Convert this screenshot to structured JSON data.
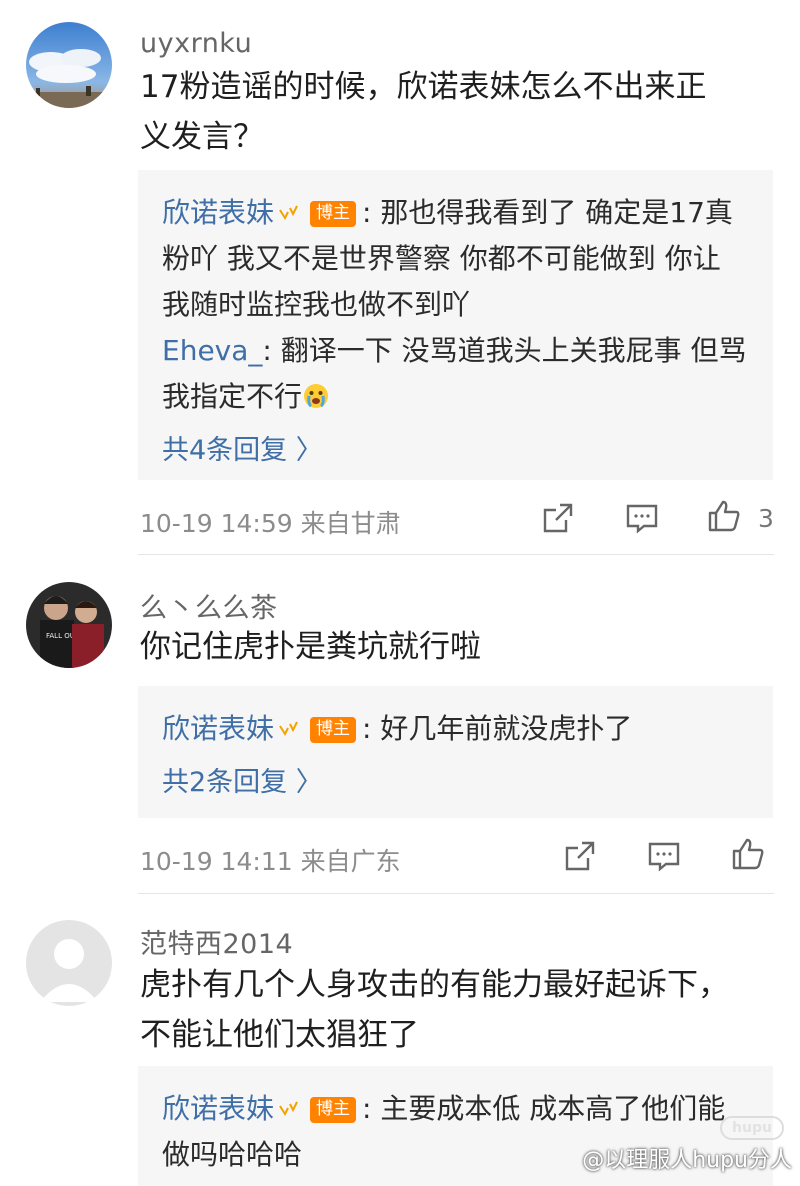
{
  "comments": [
    {
      "username": "uyxrnku",
      "text_line1": "17粉造谣的时候，欣诺表妹怎么不出来正",
      "text_line2": "义发言？",
      "replies": [
        {
          "name": "欣诺表妹",
          "badge": "博主",
          "line1": ": 那也得我看到了 确定是17真",
          "line2": "粉吖 我又不是世界警察  你都不可能做到 你让",
          "line3": "我随时监控我也做不到吖"
        },
        {
          "name": "Eheva_",
          "line1": ": 翻译一下 没骂道我头上关我屁事 但骂",
          "line2": "我指定不行"
        }
      ],
      "more_replies": "共4条回复 〉",
      "meta": "10-19 14:59  来自甘肃",
      "like_count": "3"
    },
    {
      "username": "么丶么么茶",
      "text_line1": "你记住虎扑是粪坑就行啦",
      "replies": [
        {
          "name": "欣诺表妹",
          "badge": "博主",
          "line1": ": 好几年前就没虎扑了"
        }
      ],
      "more_replies": "共2条回复 〉",
      "meta": "10-19 14:11  来自广东"
    },
    {
      "username": "范特西2014",
      "text_line1": "虎扑有几个人身攻击的有能力最好起诉下，",
      "text_line2": "不能让他们太猖狂了",
      "replies": [
        {
          "name": "欣诺表妹",
          "badge": "博主",
          "line1": ": 主要成本低 成本高了他们能",
          "line2": "做吗哈哈哈"
        }
      ]
    }
  ],
  "watermark": "@以理服人hupu分人",
  "hupu_logo": "hupu",
  "colors": {
    "link_blue": "#3f6fa6",
    "badge_orange": "#ff8200",
    "reply_bg": "#f6f6f6"
  },
  "icons": [
    "share-icon",
    "comment-icon",
    "like-icon",
    "verified-v-icon",
    "crying-emoji-icon"
  ]
}
